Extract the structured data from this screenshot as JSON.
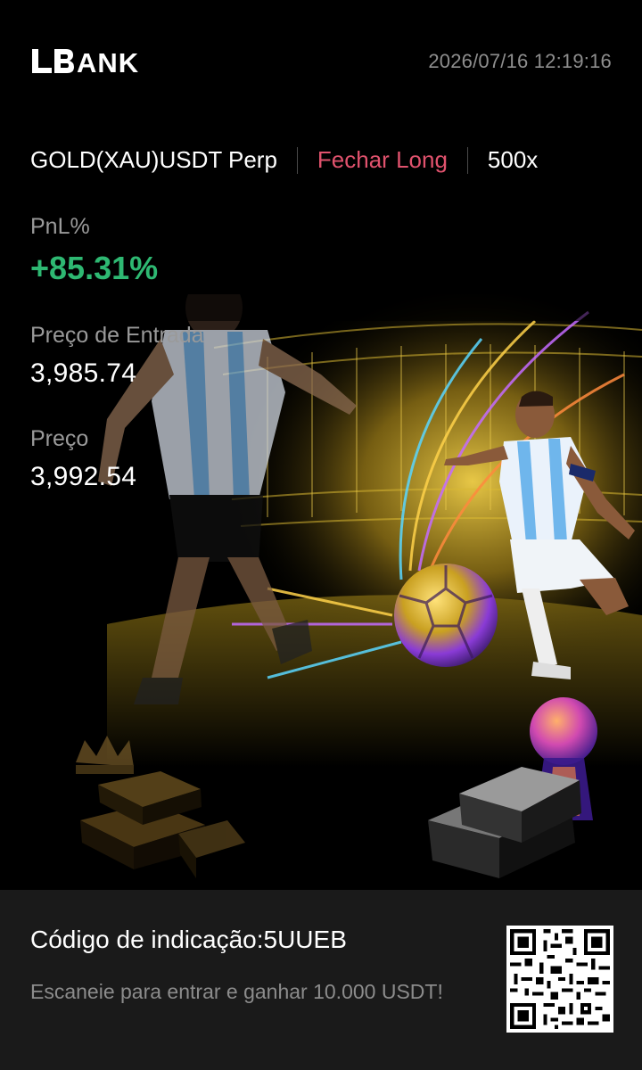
{
  "header": {
    "brand": "LBANK",
    "timestamp": "2026/07/16 12:19:16"
  },
  "trade": {
    "symbol": "GOLD(XAU)USDT Perp",
    "side": "Fechar Long",
    "leverage": "500x"
  },
  "metrics": {
    "pnl_label": "PnL%",
    "pnl_value": "+85.31%",
    "entry_label": "Preço de Entrada",
    "entry_value": "3,985.74",
    "price_label": "Preço",
    "price_value": "3,992.54"
  },
  "footer": {
    "referral": "Código de indicação:5UUEB",
    "cta": "Escaneie para entrar e ganhar 10.000 USDT!"
  },
  "colors": {
    "background": "#000000",
    "pnl_positive": "#2eb872",
    "side_close_long": "#e0526d",
    "label_gray": "#9a9a9a",
    "footer_bg": "#1a1a1a"
  },
  "icons": [
    "lbank-logo",
    "qr-code-icon",
    "gold-bars-icon",
    "crown-icon",
    "trophy-icon",
    "soccer-ball-icon"
  ]
}
